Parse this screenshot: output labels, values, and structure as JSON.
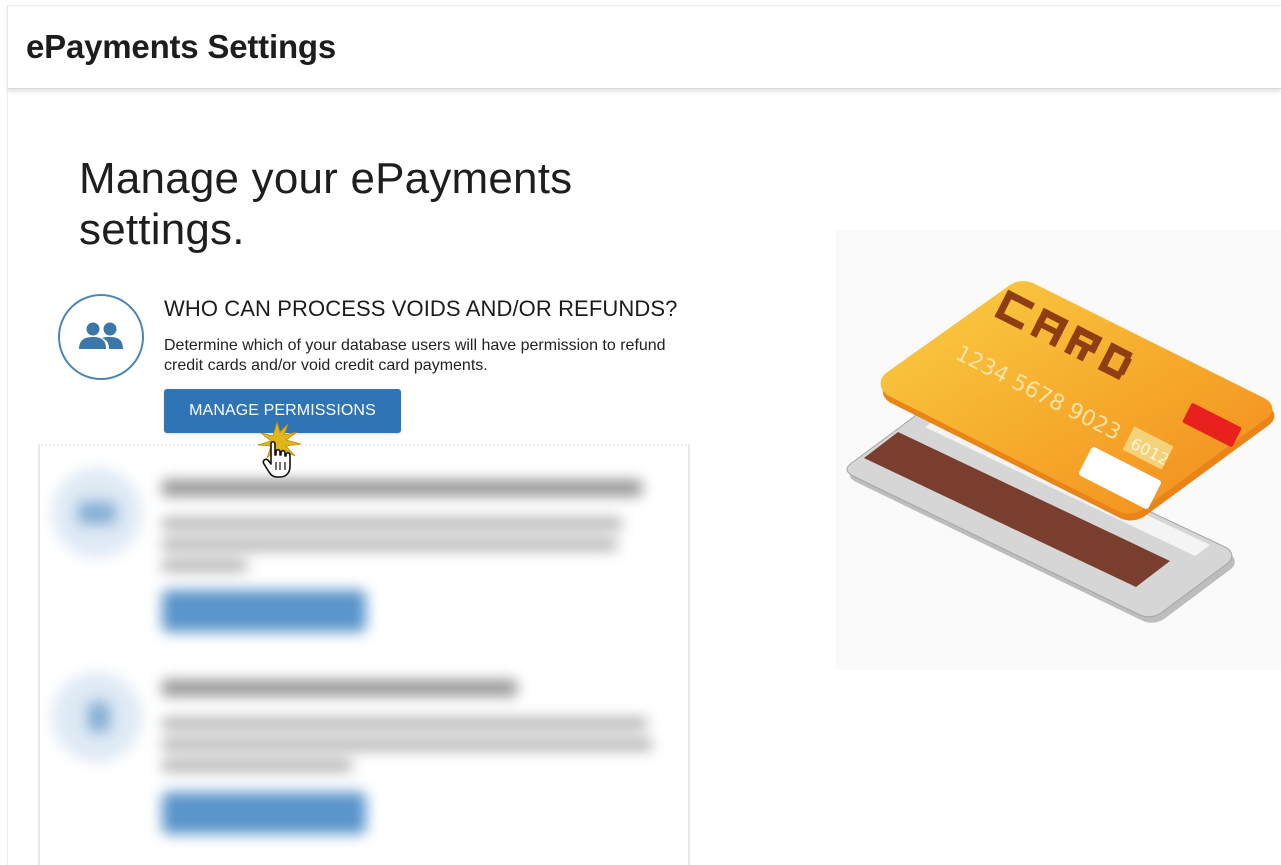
{
  "header": {
    "title": "ePayments Settings"
  },
  "main": {
    "headline": "Manage your ePayments settings."
  },
  "sections": [
    {
      "icon": "users-icon",
      "title": "WHO CAN PROCESS VOIDS AND/OR REFUNDS?",
      "description": "Determine which of your database users will have permission to refund credit cards and/or void credit card payments.",
      "button_label": "MANAGE PERMISSIONS"
    }
  ],
  "illustration": {
    "card_label": "CARD",
    "card_number": "1234 5678 9023",
    "card_extra": "6012"
  },
  "colors": {
    "accent": "#2f74b5",
    "icon_ring": "#4a86b5",
    "card_orange": "#f7a629",
    "card_chip": "#e8201e"
  }
}
